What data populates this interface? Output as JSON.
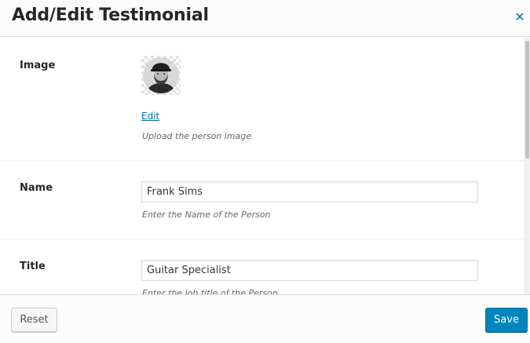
{
  "modal": {
    "title": "Add/Edit Testimonial",
    "close_icon": "close-icon"
  },
  "fields": {
    "image": {
      "label": "Image",
      "edit_link": "Edit",
      "help": "Upload the person image"
    },
    "name": {
      "label": "Name",
      "value": "Frank Sims",
      "help": "Enter the Name of the Person"
    },
    "title": {
      "label": "Title",
      "value": "Guitar Specialist",
      "help": "Enter the job title of the Person"
    }
  },
  "footer": {
    "reset_label": "Reset",
    "save_label": "Save"
  },
  "colors": {
    "accent": "#0073aa",
    "primary_button": "#0085ba"
  }
}
